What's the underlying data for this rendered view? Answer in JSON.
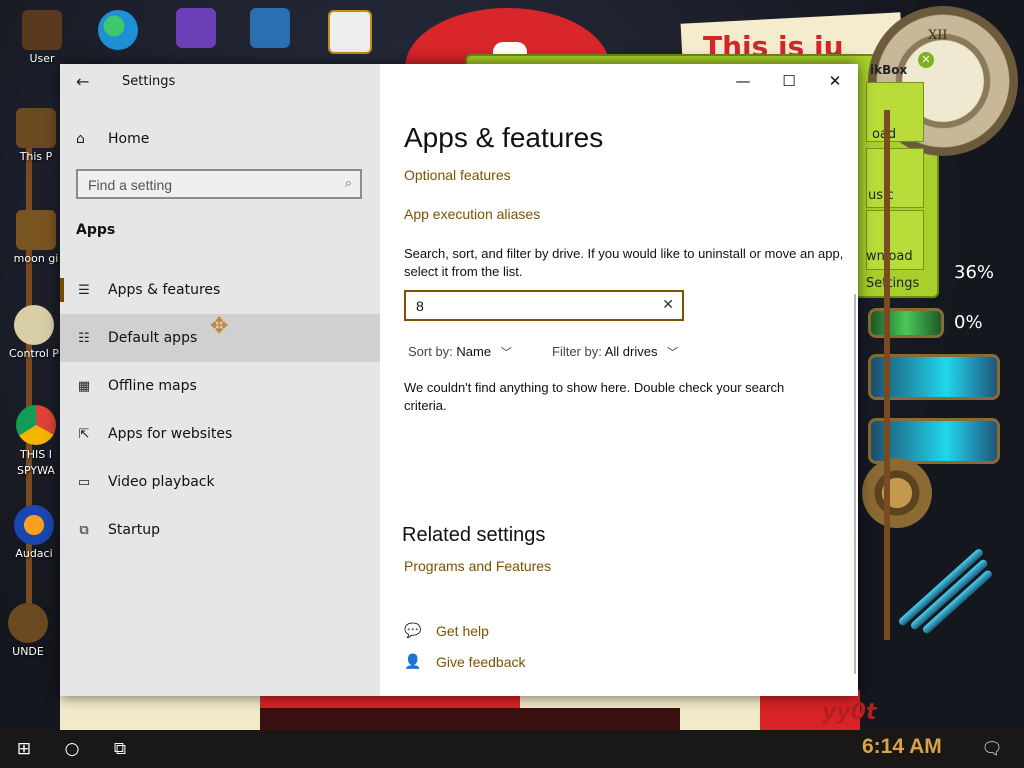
{
  "window": {
    "title": "Settings",
    "back_icon": "back-arrow-icon",
    "controls": {
      "minimize": "—",
      "maximize": "☐",
      "close": "✕"
    }
  },
  "sidebar": {
    "home_label": "Home",
    "search_placeholder": "Find a setting",
    "section_label": "Apps",
    "items": [
      {
        "label": "Apps & features",
        "icon": "list-icon",
        "selected": true
      },
      {
        "label": "Default apps",
        "icon": "default-list-icon",
        "hovered": true
      },
      {
        "label": "Offline maps",
        "icon": "map-icon"
      },
      {
        "label": "Apps for websites",
        "icon": "web-link-icon"
      },
      {
        "label": "Video playback",
        "icon": "video-icon"
      },
      {
        "label": "Startup",
        "icon": "startup-icon"
      }
    ]
  },
  "main": {
    "title": "Apps & features",
    "links": {
      "optional_features": "Optional features",
      "app_execution_aliases": "App execution aliases"
    },
    "description": "Search, sort, and filter by drive. If you would like to uninstall or move an app, select it from the list.",
    "search_value": "8",
    "sort_label": "Sort by:",
    "sort_value": "Name",
    "filter_label": "Filter by:",
    "filter_value": "All drives",
    "empty_message": "We couldn't find anything to show here. Double check your search criteria.",
    "related_title": "Related settings",
    "related_link": "Programs and Features",
    "get_help": "Get help",
    "give_feedback": "Give feedback"
  },
  "desktop": {
    "icon_labels": [
      "User",
      "This P",
      "moon gi",
      "Control P",
      "THIS I SPYWA",
      "Audaci",
      "UNDE"
    ],
    "banner_text": "This is ju",
    "gadget_title": "ikBox",
    "gadget_labels": [
      "oad",
      "usic",
      "wnload"
    ],
    "gadget_settings": "Settings",
    "gauge_top": "36%",
    "gauge_bottom": "0%",
    "bottom_text": "yy0t"
  },
  "taskbar": {
    "time": "6:14 AM"
  }
}
